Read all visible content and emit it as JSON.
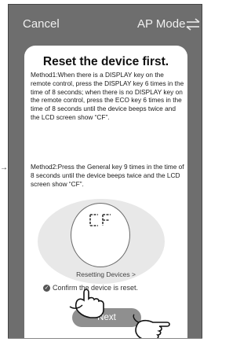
{
  "header": {
    "cancel_label": "Cancel",
    "mode_label": "AP Mode"
  },
  "card": {
    "title": "Reset the device first.",
    "method1": "Method1:When there is a DISPLAY key on the remote control, press the DISPLAY key 6 times in the time of 8 seconds; when there is no DISPLAY key on the remote control, press the ECO key 6 times in the time of 8 seconds until the device beeps twice and the LCD screen show “CF”.",
    "method2": "Method2:Press the General key 9 times in the time of 8 seconds until the device beeps twice and the LCD screen show “CF”.",
    "lcd_text": "CF",
    "resetting_link": "Resetting Devices >",
    "confirm_label": "Confirm the device is reset.",
    "next_label": "Next"
  },
  "icons": {
    "switch": "swap-arrows-icon",
    "check": "check-circle-icon",
    "hand": "pointing-hand-icon"
  },
  "colors": {
    "background": "#6e6e6e",
    "card": "#ffffff",
    "button": "#8f8f8f"
  }
}
